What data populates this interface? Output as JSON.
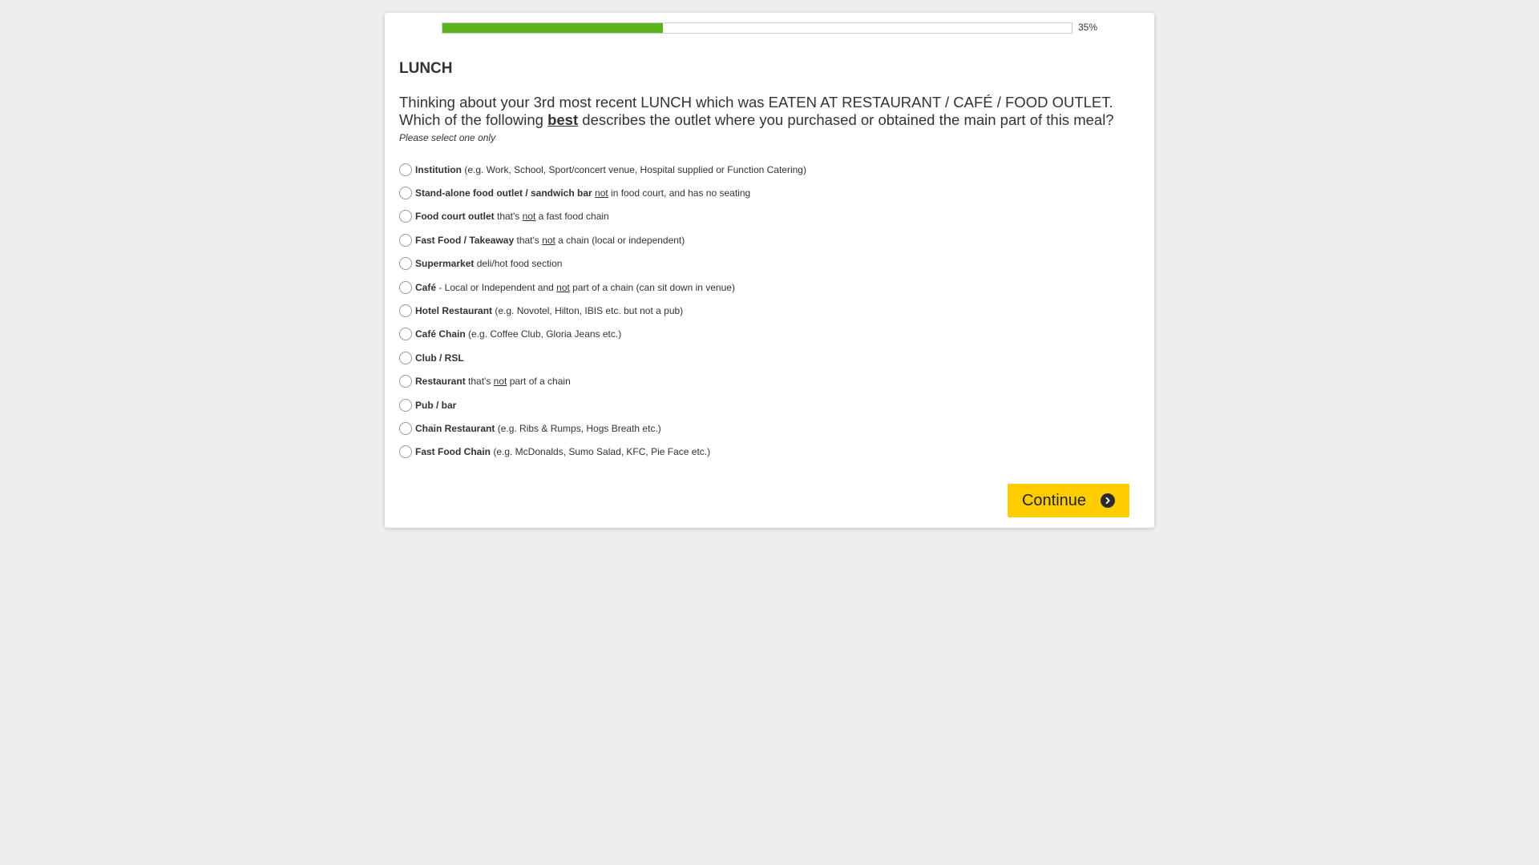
{
  "progress": {
    "value": 0.35,
    "label": "35%",
    "fill_color": "#5cb31a"
  },
  "section": {
    "title": "LUNCH"
  },
  "question": {
    "line1": "Thinking about your 3rd most recent LUNCH which was EATEN AT RESTAURANT / CAFÉ / FOOD OUTLET.",
    "line2_before": "Which of the following ",
    "line2_emphasis": "best",
    "line2_after": " describes the outlet where you purchased or obtained the main part of this meal?",
    "instruction": "Please select one only"
  },
  "options": [
    {
      "bold": "Institution",
      "pre": "",
      "underline": "",
      "post": " (e.g. Work, School, Sport/concert venue, Hospital supplied or Function Catering)"
    },
    {
      "bold": "Stand-alone food outlet / sandwich bar",
      "pre": " ",
      "underline": "not",
      "post": " in food court, and has no seating"
    },
    {
      "bold": "Food court outlet",
      "pre": " that's ",
      "underline": "not",
      "post": " a fast food chain"
    },
    {
      "bold": "Fast Food / Takeaway",
      "pre": " that's ",
      "underline": "not",
      "post": " a chain (local or independent)"
    },
    {
      "bold": "Supermarket",
      "pre": "",
      "underline": "",
      "post": " deli/hot food section"
    },
    {
      "bold": "Café",
      "pre": " - Local or Independent and ",
      "underline": "not",
      "post": " part of a chain (can sit down in venue)"
    },
    {
      "bold": "Hotel Restaurant",
      "pre": "",
      "underline": "",
      "post": " (e.g. Novotel, Hilton, IBIS etc. but not a pub)"
    },
    {
      "bold": "Café Chain",
      "pre": "",
      "underline": "",
      "post": " (e.g. Coffee Club, Gloria Jeans etc.)"
    },
    {
      "bold": "Club / RSL",
      "pre": "",
      "underline": "",
      "post": ""
    },
    {
      "bold": "Restaurant",
      "pre": " that's ",
      "underline": "not",
      "post": " part of a chain"
    },
    {
      "bold": "Pub / bar",
      "pre": "",
      "underline": "",
      "post": ""
    },
    {
      "bold": "Chain Restaurant",
      "pre": "",
      "underline": "",
      "post": " (e.g. Ribs & Rumps, Hogs Breath etc.)"
    },
    {
      "bold": "Fast Food Chain",
      "pre": "",
      "underline": "",
      "post": " (e.g. McDonalds, Sumo Salad, KFC, Pie Face etc.)"
    }
  ],
  "continue_button": {
    "label": "Continue",
    "icon": "arrow-right-circle-icon",
    "color": "#ffcc00"
  }
}
